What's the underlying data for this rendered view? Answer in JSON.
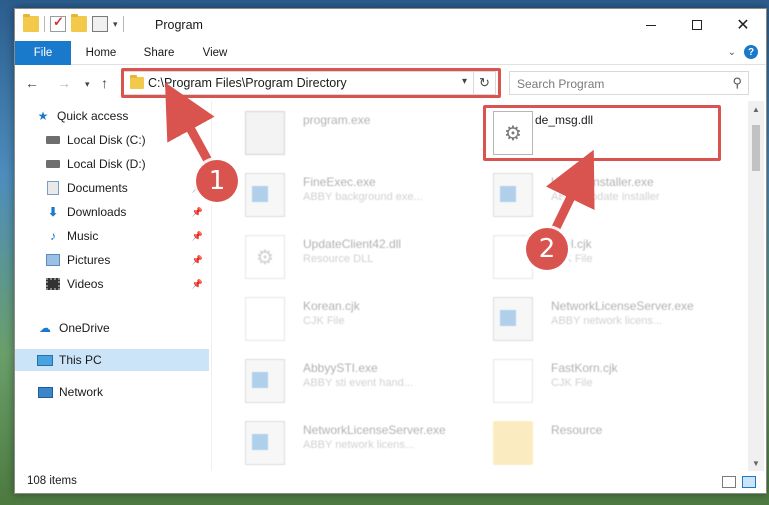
{
  "titlebar": {
    "title": "Program"
  },
  "ribbon": {
    "tabs": [
      "File",
      "Home",
      "Share",
      "View"
    ]
  },
  "address": {
    "path": "C:\\Program Files\\Program Directory"
  },
  "search": {
    "placeholder": "Search Program"
  },
  "sidebar": {
    "items": [
      {
        "label": "Quick access",
        "icon": "star-icon",
        "pinned": false
      },
      {
        "label": "Local Disk (C:)",
        "icon": "disk-icon",
        "pinned": false
      },
      {
        "label": "Local Disk (D:)",
        "icon": "disk-icon",
        "pinned": false
      },
      {
        "label": "Documents",
        "icon": "documents-icon",
        "pinned": true
      },
      {
        "label": "Downloads",
        "icon": "downloads-icon",
        "pinned": true
      },
      {
        "label": "Music",
        "icon": "music-icon",
        "pinned": true
      },
      {
        "label": "Pictures",
        "icon": "pictures-icon",
        "pinned": true
      },
      {
        "label": "Videos",
        "icon": "videos-icon",
        "pinned": true
      },
      {
        "label": "OneDrive",
        "icon": "cloud-icon",
        "pinned": false
      },
      {
        "label": "This PC",
        "icon": "computer-icon",
        "pinned": false,
        "selected": true
      },
      {
        "label": "Network",
        "icon": "network-icon",
        "pinned": false
      }
    ]
  },
  "files": [
    {
      "name": "program.exe",
      "desc": ""
    },
    {
      "name": "de_msg.dll",
      "desc": ""
    },
    {
      "name": "FineExec.exe",
      "desc": "ABBY background exe..."
    },
    {
      "name": "UpdateInstaller.exe",
      "desc": "ABBY Update installer"
    },
    {
      "name": "UpdateClient42.dll",
      "desc": "Resource DLL"
    },
    {
      "name": "html.cjk",
      "desc": "CJK File"
    },
    {
      "name": "Korean.cjk",
      "desc": "CJK File"
    },
    {
      "name": "NetworkLicenseServer.exe",
      "desc": "ABBY network licens..."
    },
    {
      "name": "AbbyySTI.exe",
      "desc": "ABBY sti event hand..."
    },
    {
      "name": "FastKorn.cjk",
      "desc": "CJK File"
    },
    {
      "name": "NetworkLicenseServer.exe",
      "desc": "ABBY network licens..."
    },
    {
      "name": "Resource",
      "desc": ""
    }
  ],
  "status": {
    "count": "108 items"
  },
  "annotations": {
    "step1": "1",
    "step2": "2"
  },
  "colors": {
    "accent": "#1979ca",
    "highlight": "#d9534f",
    "selected": "#cce4f7"
  }
}
